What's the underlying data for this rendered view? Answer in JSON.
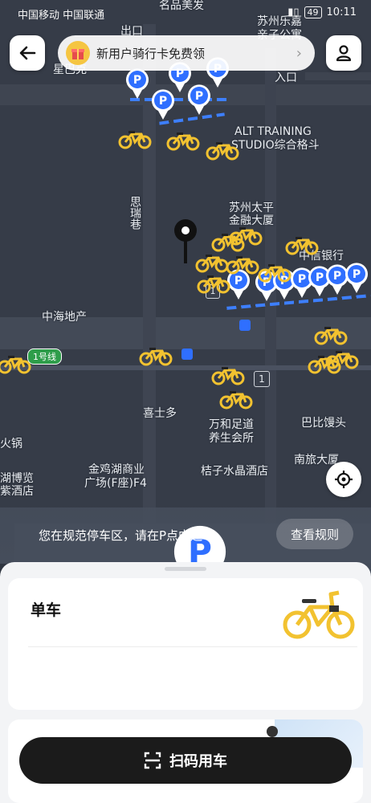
{
  "status_bar": {
    "carrier": "中国移动 中国联通",
    "battery": "49",
    "time": "10:11"
  },
  "promo_banner": {
    "text": "新用户骑行卡免费领"
  },
  "map_labels": [
    {
      "id": "mingpin",
      "text": "名品美发"
    },
    {
      "id": "chukou",
      "text": "出口"
    },
    {
      "id": "suzhou-lexiang",
      "text": "苏州乐嘉"
    },
    {
      "id": "qinzi",
      "text": "亲子公寓"
    },
    {
      "id": "xingbake",
      "text": "星巴克"
    },
    {
      "id": "rukou",
      "text": "入口"
    },
    {
      "id": "alt1",
      "text": "ALT TRAINING"
    },
    {
      "id": "alt2",
      "text": "STUDIO综合格斗"
    },
    {
      "id": "sirui",
      "text": "思瑞巷"
    },
    {
      "id": "suzhou-taiping",
      "text": "苏州太平"
    },
    {
      "id": "jinrong",
      "text": "金融大厦"
    },
    {
      "id": "yinhang",
      "text": "中信银行"
    },
    {
      "id": "zhonghai",
      "text": "中海地产"
    },
    {
      "id": "line1",
      "text": "1号线"
    },
    {
      "id": "xishiduo",
      "text": "喜士多"
    },
    {
      "id": "wanhe1",
      "text": "万和足道"
    },
    {
      "id": "wanhe2",
      "text": "养生会所"
    },
    {
      "id": "babi",
      "text": "巴比馒头"
    },
    {
      "id": "nanlv",
      "text": "南旅大厦"
    },
    {
      "id": "huoguo",
      "text": "火锅"
    },
    {
      "id": "bowu",
      "text": "湖博览"
    },
    {
      "id": "jiudian",
      "text": "紫酒店"
    },
    {
      "id": "jinji1",
      "text": "金鸡湖商业"
    },
    {
      "id": "jinji2",
      "text": "广场(F座)F4"
    },
    {
      "id": "juzi",
      "text": "桔子水晶酒店"
    }
  ],
  "route_badge": "1",
  "parking_notice": {
    "text": "您在规范停车区，请在P点内还车",
    "rule_button": "查看规则"
  },
  "bike_card": {
    "title": "单车"
  },
  "scan_button": {
    "label": "扫码用车"
  },
  "colors": {
    "accent_blue": "#2f6fff",
    "bike_yellow": "#f2c230",
    "scan_bg": "#1b1b1b"
  }
}
